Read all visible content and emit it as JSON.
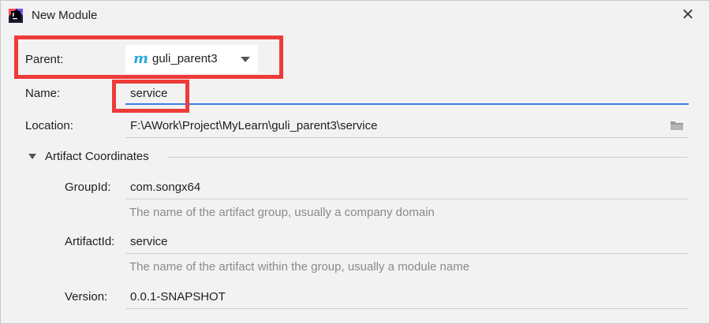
{
  "dialog": {
    "title": "New Module"
  },
  "form": {
    "parent": {
      "label": "Parent:",
      "value": "guli_parent3",
      "logo": "m"
    },
    "name": {
      "label": "Name:",
      "value": "service"
    },
    "location": {
      "label": "Location:",
      "value": "F:\\AWork\\Project\\MyLearn\\guli_parent3\\service"
    }
  },
  "artifact": {
    "section_label": "Artifact Coordinates",
    "group_id": {
      "label": "GroupId:",
      "value": "com.songx64",
      "hint": "The name of the artifact group, usually a company domain"
    },
    "artifact_id": {
      "label": "ArtifactId:",
      "value": "service",
      "hint": "The name of the artifact within the group, usually a module name"
    },
    "version": {
      "label": "Version:",
      "value": "0.0.1-SNAPSHOT"
    }
  },
  "colors": {
    "highlight": "#ef3a3a",
    "focus": "#3c7ee3",
    "maven_logo": "#2aa8d8"
  },
  "icons": [
    "intellij-app-icon",
    "close-icon",
    "chevron-down-icon",
    "folder-icon",
    "maven-m-icon"
  ]
}
